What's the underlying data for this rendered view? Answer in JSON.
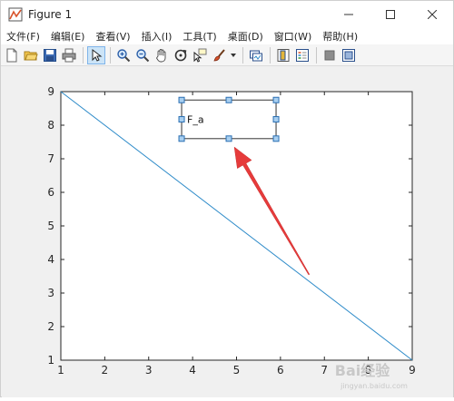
{
  "window": {
    "title": "Figure 1",
    "minimize_icon": "minimize-icon",
    "maximize_icon": "maximize-icon",
    "close_icon": "close-icon"
  },
  "menu": {
    "items": [
      {
        "label": "文件(F)"
      },
      {
        "label": "编辑(E)"
      },
      {
        "label": "查看(V)"
      },
      {
        "label": "插入(I)"
      },
      {
        "label": "工具(T)"
      },
      {
        "label": "桌面(D)"
      },
      {
        "label": "窗口(W)"
      },
      {
        "label": "帮助(H)"
      }
    ]
  },
  "toolbar": {
    "buttons": [
      {
        "icon": "new-figure-icon"
      },
      {
        "icon": "open-file-icon"
      },
      {
        "icon": "save-icon"
      },
      {
        "icon": "print-icon"
      },
      {
        "icon": "edit-plot-pointer-icon",
        "selected": true
      },
      {
        "icon": "zoom-in-icon"
      },
      {
        "icon": "zoom-out-icon"
      },
      {
        "icon": "pan-hand-icon"
      },
      {
        "icon": "rotate-3d-icon"
      },
      {
        "icon": "data-cursor-icon"
      },
      {
        "icon": "brush-icon"
      },
      {
        "icon": "link-plot-icon"
      },
      {
        "icon": "insert-colorbar-icon"
      },
      {
        "icon": "insert-legend-icon"
      },
      {
        "icon": "hide-plot-tools-icon"
      },
      {
        "icon": "show-plot-tools-icon"
      }
    ]
  },
  "chart_data": {
    "type": "line",
    "series": [
      {
        "x": [
          1,
          9
        ],
        "y": [
          9,
          1
        ],
        "color": "#2e8bc9"
      }
    ],
    "xlim": [
      1,
      9
    ],
    "ylim": [
      1,
      9
    ],
    "xticks": [
      "1",
      "2",
      "3",
      "4",
      "5",
      "6",
      "7",
      "8",
      "9"
    ],
    "yticks": [
      "1",
      "2",
      "3",
      "4",
      "5",
      "6",
      "7",
      "8",
      "9"
    ],
    "grid": false,
    "annotations": [
      {
        "text": "F_a",
        "selected": true,
        "x_range": [
          3.75,
          5.9
        ],
        "y_range": [
          7.6,
          8.75
        ]
      }
    ],
    "arrow": {
      "color": "#e63b3b",
      "from": [
        6.65,
        3.55
      ],
      "to": [
        4.95,
        7.35
      ]
    }
  },
  "watermark": {
    "text": "Bai经验",
    "sub": "jingyan.baidu.com"
  }
}
